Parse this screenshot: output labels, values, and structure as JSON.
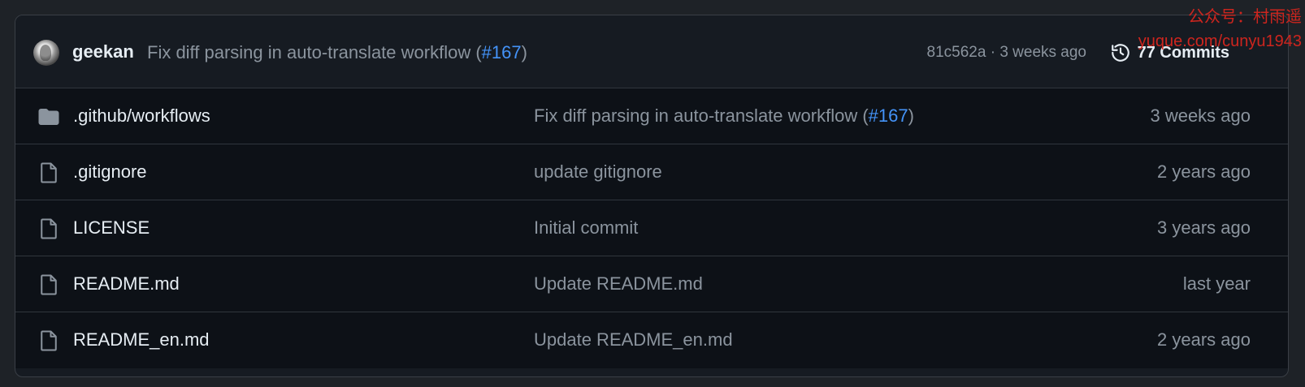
{
  "header": {
    "author": "geekan",
    "message_prefix": "Fix diff parsing in auto-translate workflow (",
    "message_link": "#167",
    "message_suffix": ")",
    "sha": "81c562a",
    "separator": " · ",
    "time": "3 weeks ago",
    "commits_label": "77 Commits",
    "history_icon": "history-clock-icon"
  },
  "watermark": {
    "line1": "公众号：村雨遥",
    "line2": "yuque.com/cunyu1943"
  },
  "files": [
    {
      "icon": "folder-icon",
      "name": ".github/workflows",
      "message_prefix": "Fix diff parsing in auto-translate workflow (",
      "message_link": "#167",
      "message_suffix": ")",
      "age": "3 weeks ago"
    },
    {
      "icon": "file-icon",
      "name": ".gitignore",
      "message_prefix": "update gitignore",
      "message_link": "",
      "message_suffix": "",
      "age": "2 years ago"
    },
    {
      "icon": "file-icon",
      "name": "LICENSE",
      "message_prefix": "Initial commit",
      "message_link": "",
      "message_suffix": "",
      "age": "3 years ago"
    },
    {
      "icon": "file-icon",
      "name": "README.md",
      "message_prefix": "Update README.md",
      "message_link": "",
      "message_suffix": "",
      "age": "last year"
    },
    {
      "icon": "file-icon",
      "name": "README_en.md",
      "message_prefix": "Update README_en.md",
      "message_link": "",
      "message_suffix": "",
      "age": "2 years ago"
    }
  ],
  "colors": {
    "link": "#4493f8",
    "muted": "#8b949e",
    "text": "#e6edf3",
    "watermark": "#d7261e"
  }
}
